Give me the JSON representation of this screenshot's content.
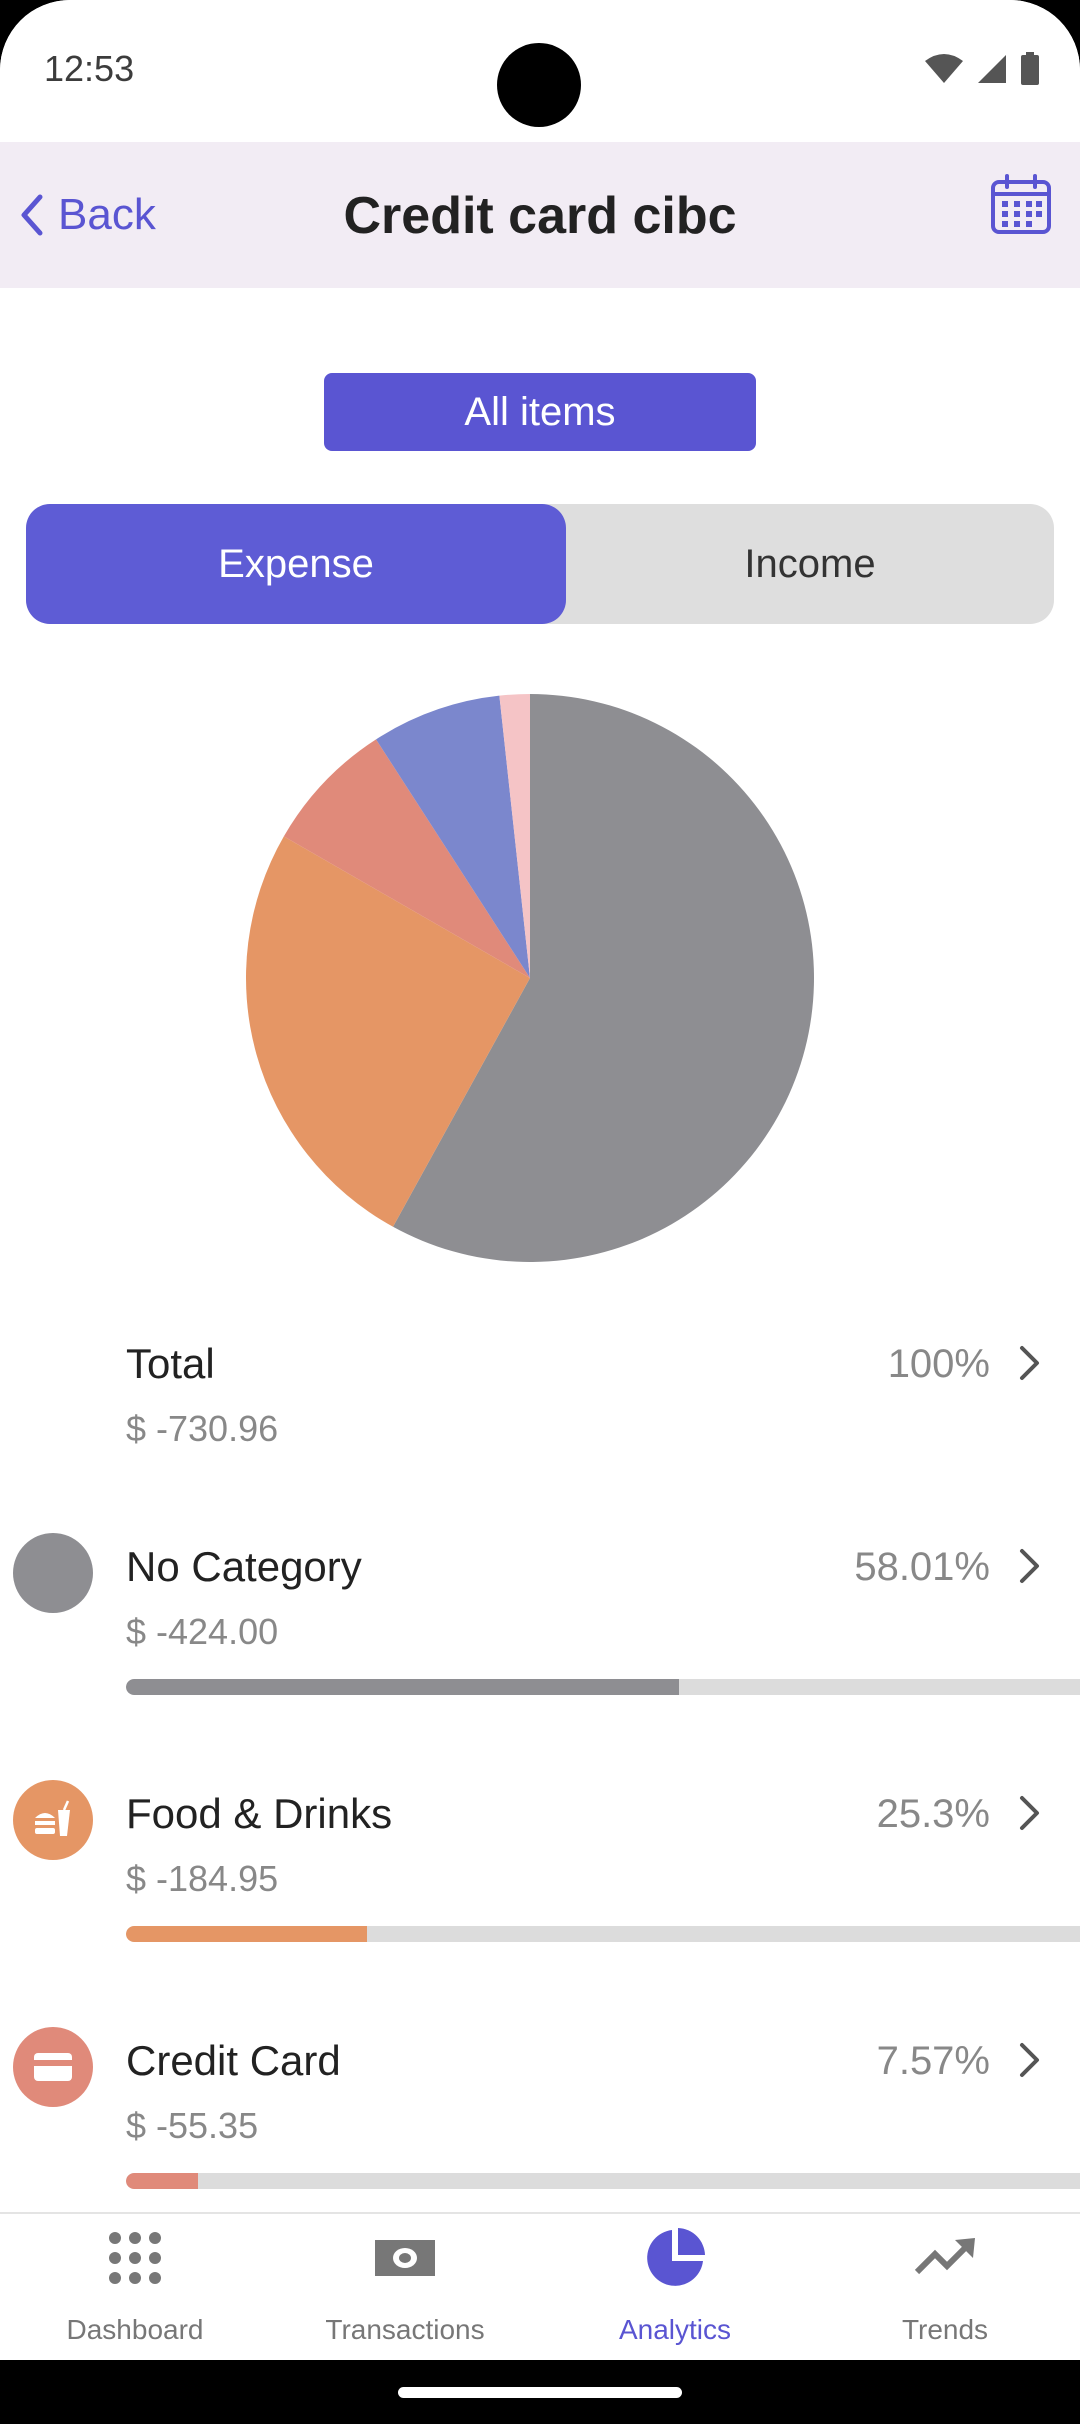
{
  "status_bar": {
    "time": "12:53"
  },
  "header": {
    "back_label": "Back",
    "title": "Credit card cibc"
  },
  "filter": {
    "all_items_label": "All items"
  },
  "segment": {
    "expense_label": "Expense",
    "income_label": "Income",
    "selected": "Expense"
  },
  "chart_data": {
    "type": "pie",
    "slices": [
      {
        "label": "No Category",
        "percent": 58.01,
        "color": "#8e8e92"
      },
      {
        "label": "Food & Drinks",
        "percent": 25.3,
        "color": "#e59665"
      },
      {
        "label": "Credit Card",
        "percent": 7.57,
        "color": "#e08a7a"
      },
      {
        "label": "",
        "percent": 7.4,
        "color": "#7b87cd"
      },
      {
        "label": "",
        "percent": 1.72,
        "color": "#f5c4c6"
      }
    ]
  },
  "list": {
    "total": {
      "name": "Total",
      "amount": "$ -730.96",
      "percent": "100%"
    },
    "items": [
      {
        "name": "No Category",
        "amount": "$ -424.00",
        "percent": "58.01%",
        "fraction": 0.5801,
        "color": "#8e8e92",
        "icon": "circle-icon"
      },
      {
        "name": "Food & Drinks",
        "amount": "$ -184.95",
        "percent": "25.3%",
        "fraction": 0.253,
        "color": "#e59665",
        "icon": "food-drinks-icon"
      },
      {
        "name": "Credit Card",
        "amount": "$ -55.35",
        "percent": "7.57%",
        "fraction": 0.0757,
        "color": "#e08a7a",
        "icon": "credit-card-icon"
      }
    ]
  },
  "bottom_nav": {
    "items": [
      {
        "label": "Dashboard",
        "icon": "dashboard-grid-icon"
      },
      {
        "label": "Transactions",
        "icon": "cash-icon"
      },
      {
        "label": "Analytics",
        "icon": "pie-chart-icon",
        "active": true
      },
      {
        "label": "Trends",
        "icon": "trending-up-icon"
      }
    ]
  },
  "colors": {
    "accent": "#5a55d2",
    "header_bg": "#f2ecf4"
  }
}
